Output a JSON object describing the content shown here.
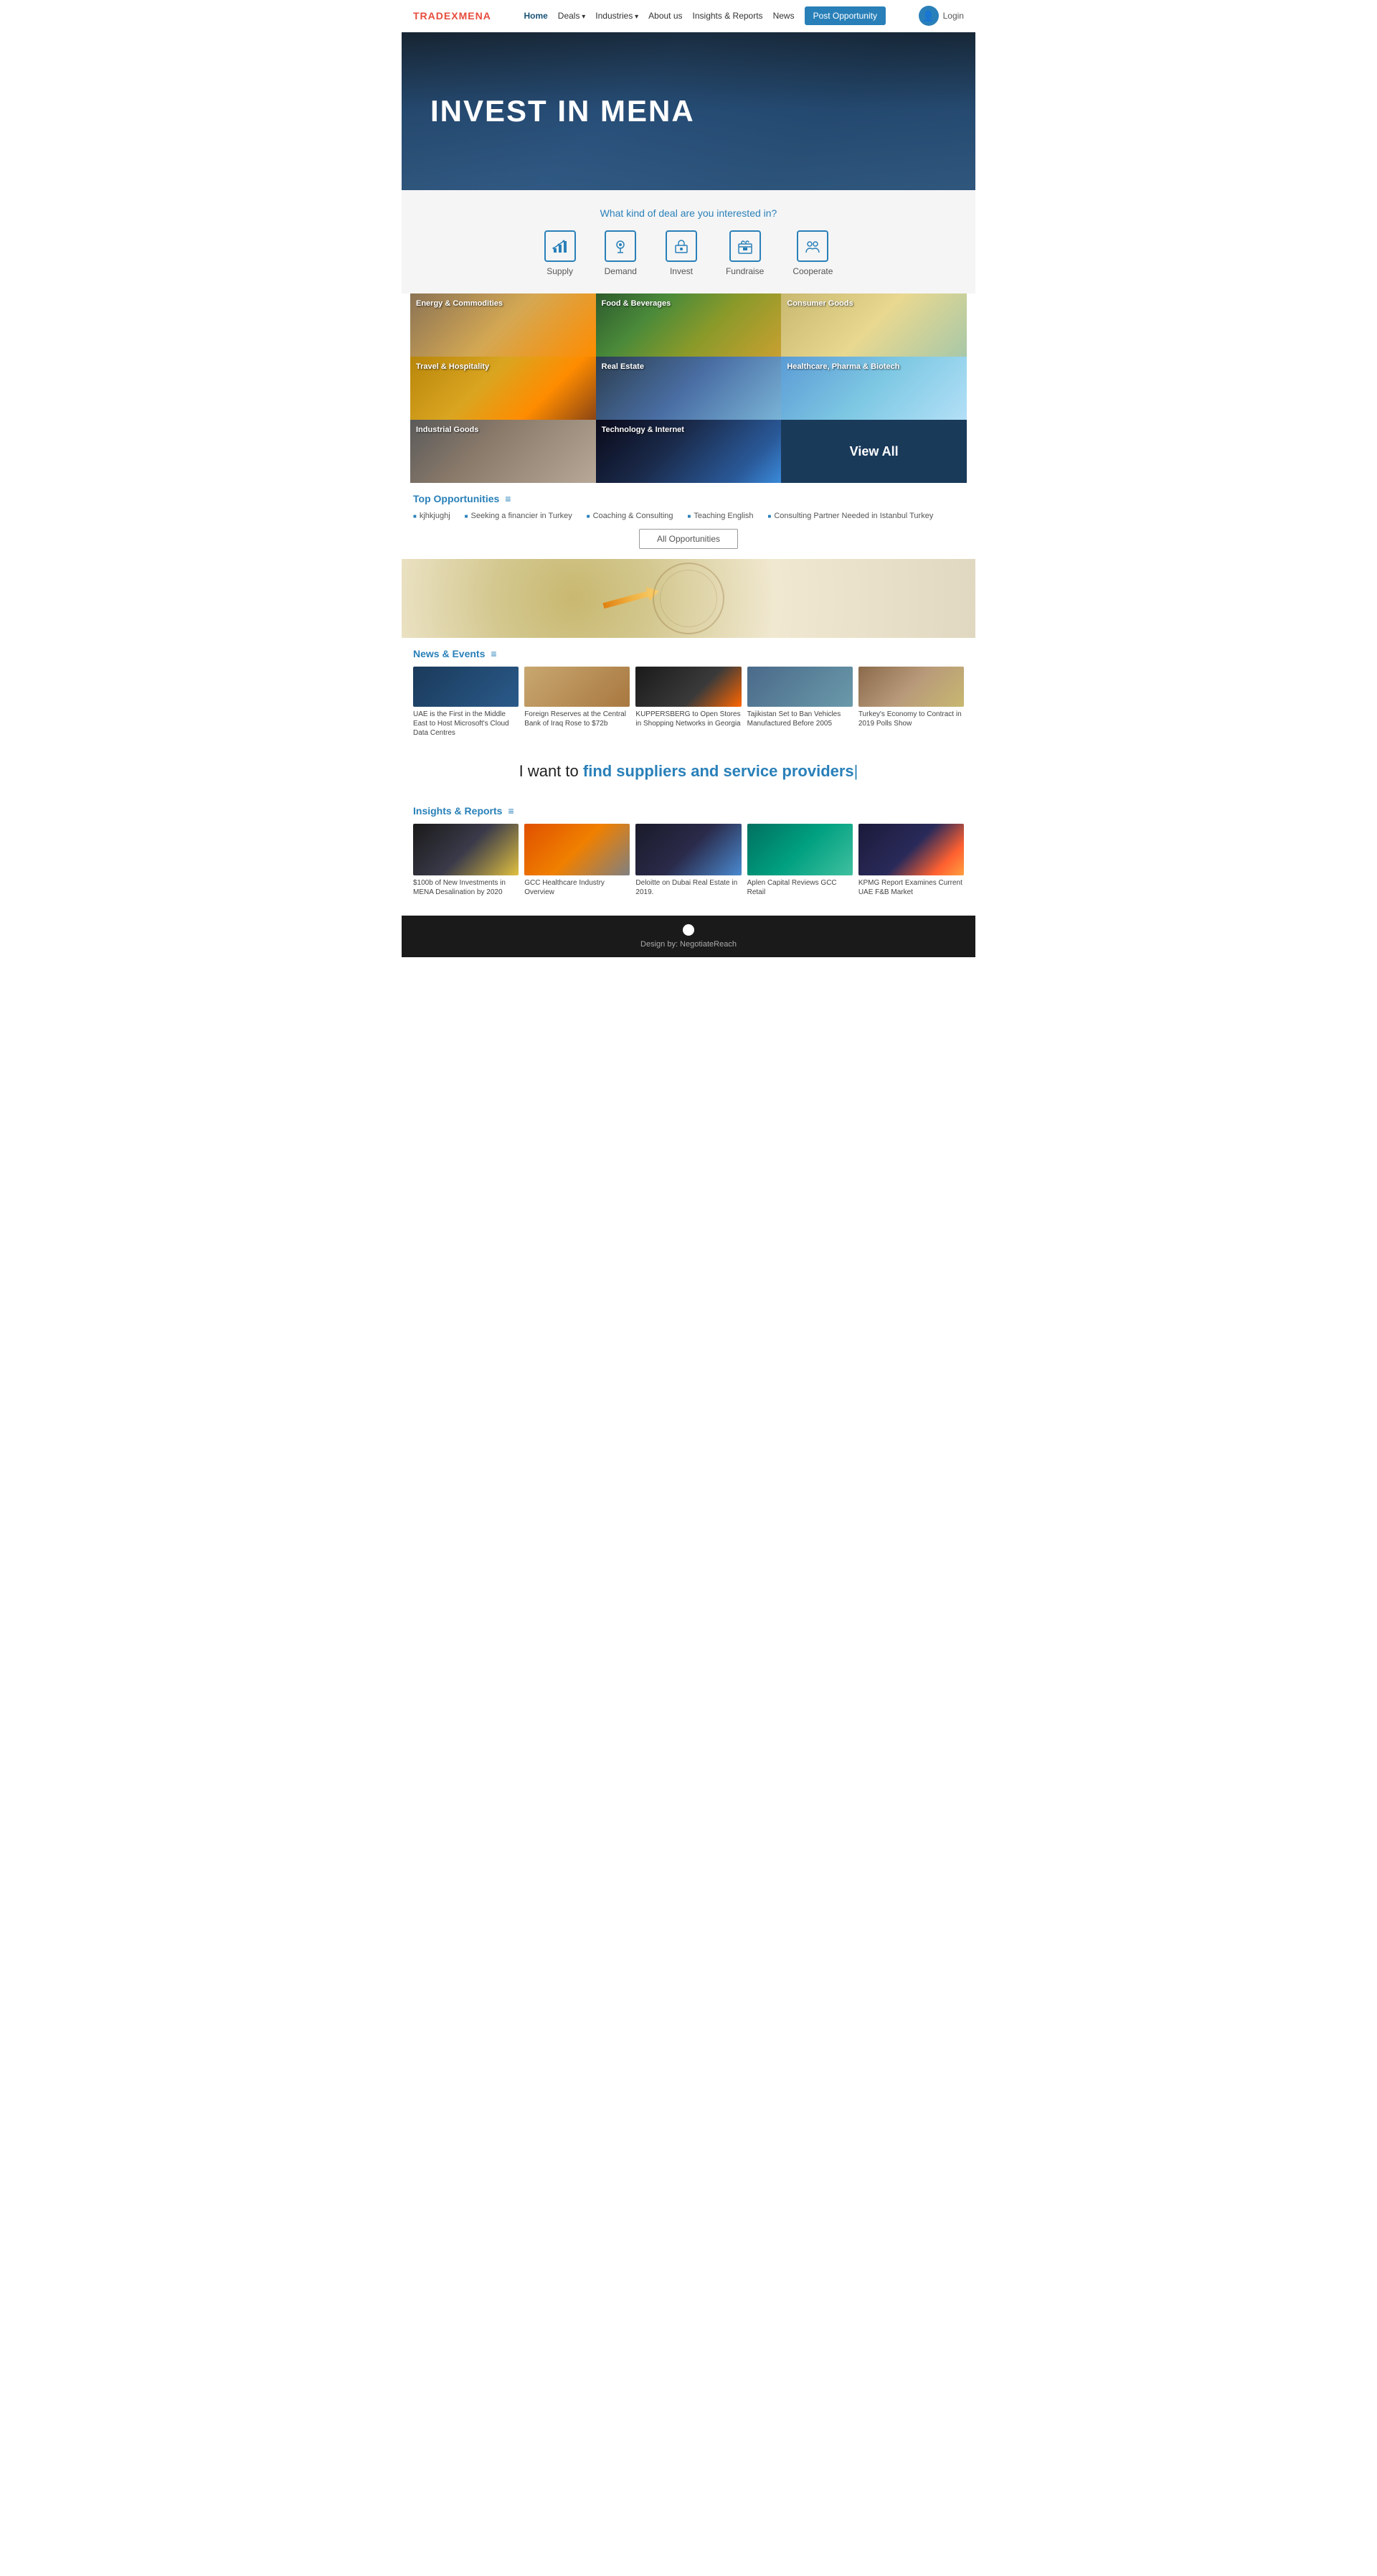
{
  "header": {
    "logo": "TRADEX",
    "logo_accent": "MENA",
    "nav": [
      {
        "label": "Home",
        "active": true,
        "has_arrow": false
      },
      {
        "label": "Deals",
        "active": false,
        "has_arrow": true
      },
      {
        "label": "Industries",
        "active": false,
        "has_arrow": true
      },
      {
        "label": "About us",
        "active": false,
        "has_arrow": false
      },
      {
        "label": "Insights & Reports",
        "active": false,
        "has_arrow": false
      },
      {
        "label": "News",
        "active": false,
        "has_arrow": false
      }
    ],
    "post_opportunity": "Post Opportunity",
    "login": "Login"
  },
  "hero": {
    "title": "INVEST IN MENA"
  },
  "deal_section": {
    "question": "What kind of deal are you interested in?",
    "types": [
      {
        "label": "Supply",
        "icon": "chart-icon"
      },
      {
        "label": "Demand",
        "icon": "tag-icon"
      },
      {
        "label": "Invest",
        "icon": "briefcase-icon"
      },
      {
        "label": "Fundraise",
        "icon": "store-icon"
      },
      {
        "label": "Cooperate",
        "icon": "handshake-icon"
      }
    ]
  },
  "industries": [
    {
      "label": "Energy & Commodities",
      "style": "card-energy"
    },
    {
      "label": "Food & Beverages",
      "style": "card-food"
    },
    {
      "label": "Consumer Goods",
      "style": "card-consumer"
    },
    {
      "label": "Travel & Hospitality",
      "style": "card-travel"
    },
    {
      "label": "Real Estate",
      "style": "card-realestate"
    },
    {
      "label": "Healthcare, Pharma & Biotech",
      "style": "card-healthcare"
    },
    {
      "label": "Industrial Goods",
      "style": "card-industrial"
    },
    {
      "label": "Technology & Internet",
      "style": "card-tech"
    },
    {
      "label": "View All",
      "style": "view-all"
    }
  ],
  "opportunities": {
    "title": "Top Opportunities",
    "items": [
      {
        "label": "kjhkjughj"
      },
      {
        "label": "Seeking a financier in Turkey"
      },
      {
        "label": "Coaching & Consulting"
      },
      {
        "label": "Teaching English"
      },
      {
        "label": "Consulting Partner Needed in Istanbul Turkey"
      }
    ],
    "all_button": "All Opportunities"
  },
  "news": {
    "title": "News & Events",
    "items": [
      {
        "img_class": "img1",
        "text": "UAE is the First in the Middle East to Host Microsoft's Cloud Data Centres"
      },
      {
        "img_class": "img2",
        "text": "Foreign Reserves at the Central Bank of Iraq Rose to $72b"
      },
      {
        "img_class": "img3",
        "text": "KUPPERSBERG to Open Stores in Shopping Networks in Georgia"
      },
      {
        "img_class": "img4",
        "text": "Tajikistan Set to Ban Vehicles Manufactured Before 2005"
      },
      {
        "img_class": "img5",
        "text": "Turkey's Economy to Contract in 2019 Polls Show"
      }
    ]
  },
  "iwantto": {
    "prefix": "I want to ",
    "highlight": "find suppliers and service providers",
    "cursor": "|"
  },
  "insights": {
    "title": "Insights & Reports",
    "items": [
      {
        "img_class": "ins1",
        "text": "$100b of New Investments in MENA Desalination by 2020"
      },
      {
        "img_class": "ins2",
        "text": "GCC Healthcare Industry Overview"
      },
      {
        "img_class": "ins3",
        "text": "Deloitte on Dubai Real Estate in 2019."
      },
      {
        "img_class": "ins4",
        "text": "Aplen Capital Reviews GCC Retail"
      },
      {
        "img_class": "ins5",
        "text": "KPMG Report Examines Current UAE F&B Market"
      }
    ]
  },
  "footer": {
    "text": "Design by: NegotiateReach"
  }
}
